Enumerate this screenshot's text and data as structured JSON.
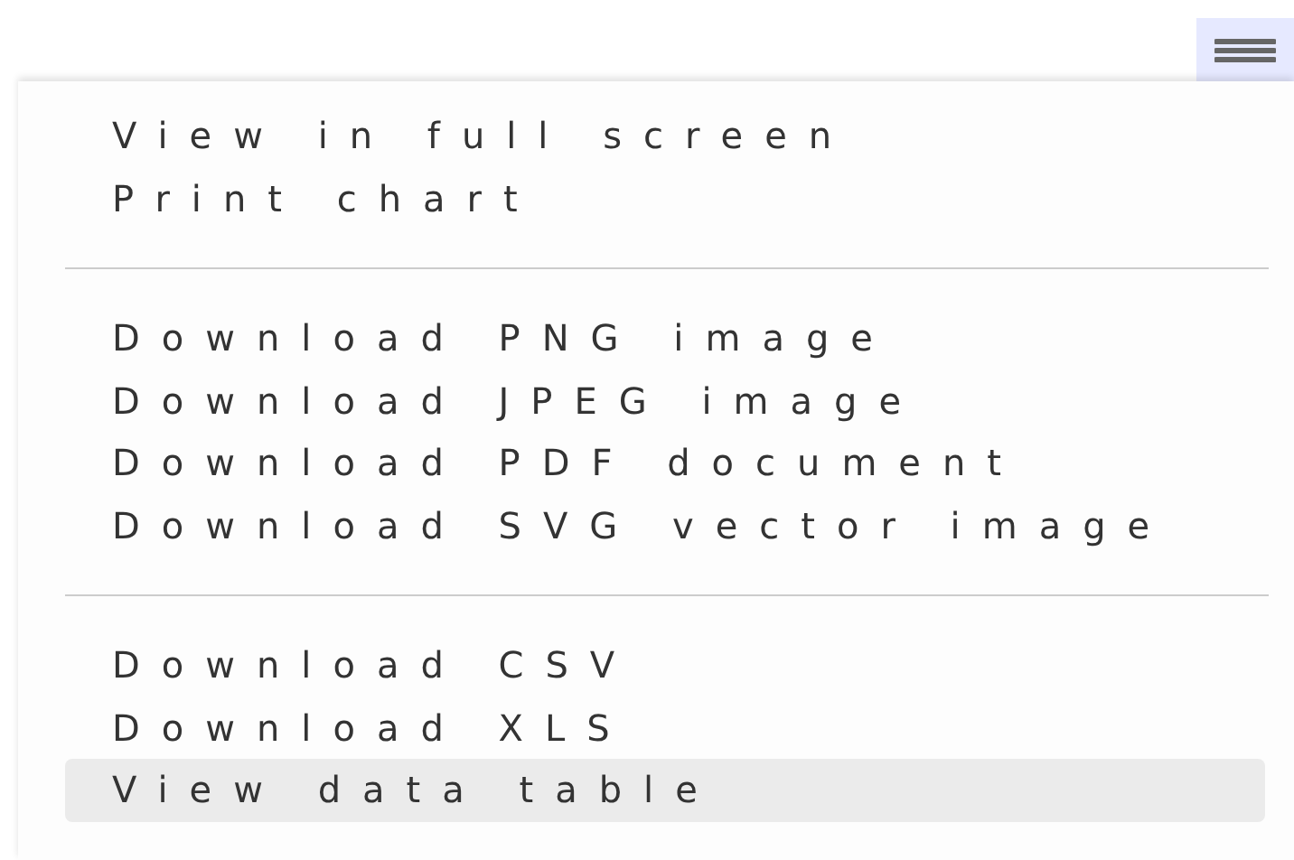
{
  "menu_button": {
    "active": true
  },
  "menu": {
    "items": [
      {
        "kind": "item",
        "label": "View in full screen",
        "highlighted": false
      },
      {
        "kind": "item",
        "label": "Print chart",
        "highlighted": false
      },
      {
        "kind": "divider"
      },
      {
        "kind": "item",
        "label": "Download PNG image",
        "highlighted": false
      },
      {
        "kind": "item",
        "label": "Download JPEG image",
        "highlighted": false
      },
      {
        "kind": "item",
        "label": "Download PDF document",
        "highlighted": false
      },
      {
        "kind": "item",
        "label": "Download SVG vector image",
        "highlighted": false
      },
      {
        "kind": "divider"
      },
      {
        "kind": "item",
        "label": "Download CSV",
        "highlighted": false
      },
      {
        "kind": "item",
        "label": "Download XLS",
        "highlighted": false
      },
      {
        "kind": "item",
        "label": "View data table",
        "highlighted": true
      }
    ]
  }
}
